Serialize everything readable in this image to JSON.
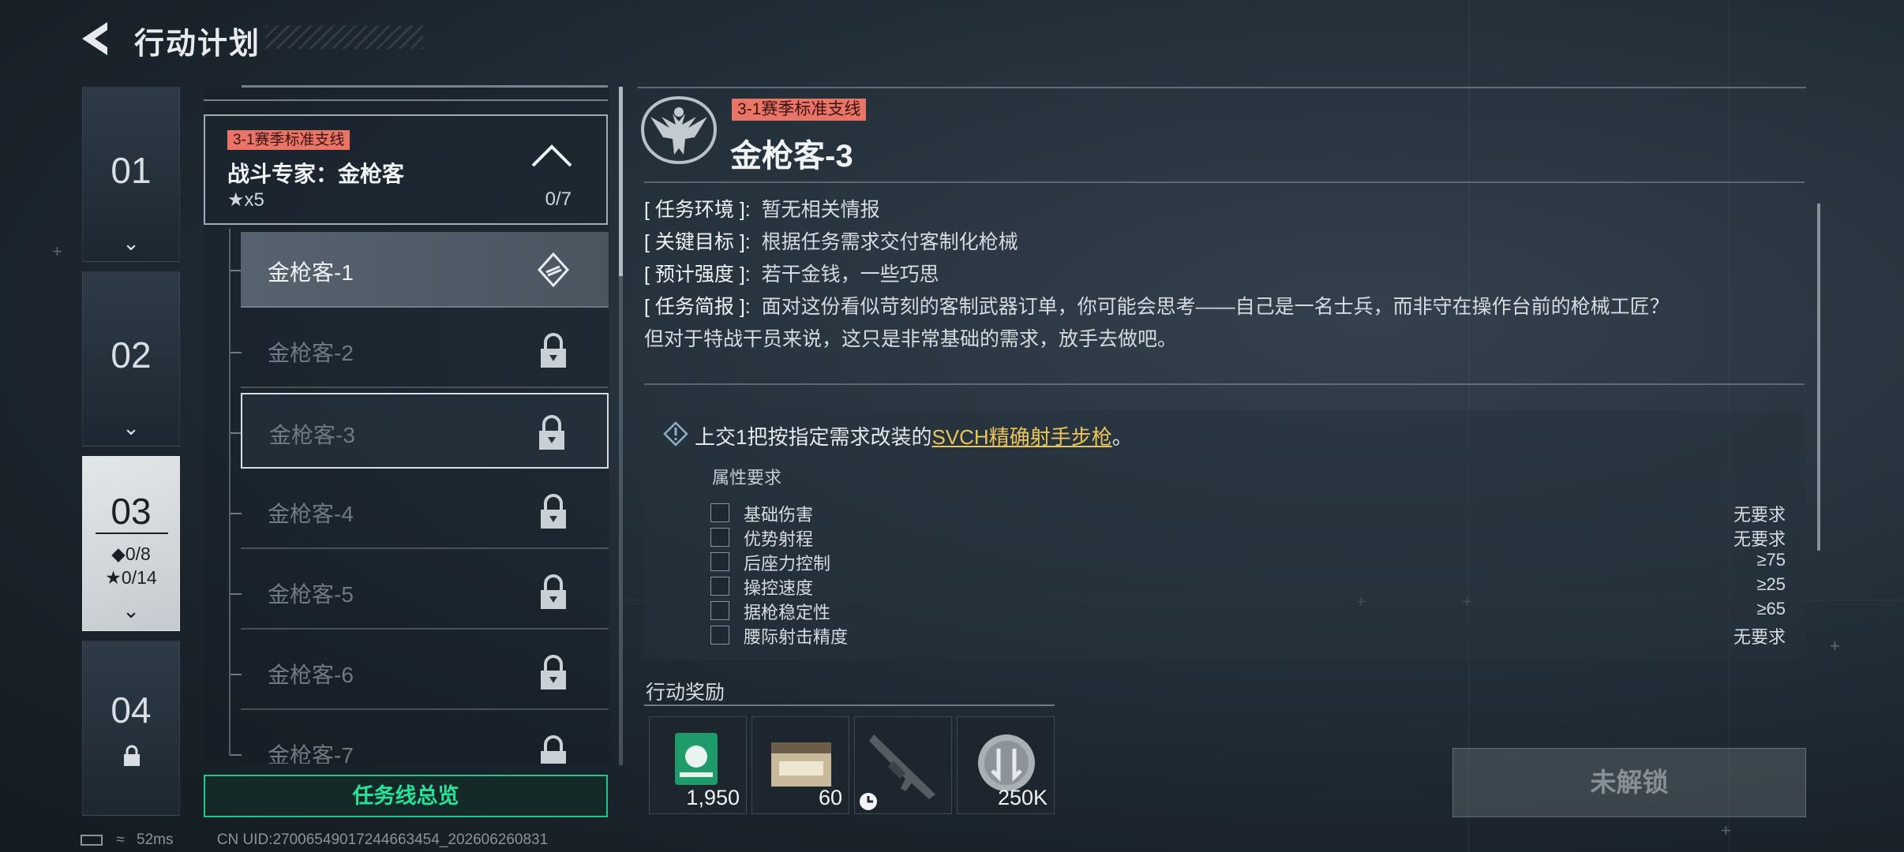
{
  "header": {
    "title": "行动计划",
    "back_icon": "back-arrow-icon"
  },
  "chapters": [
    {
      "num": "01"
    },
    {
      "num": "02"
    },
    {
      "num": "03",
      "diamond": "◆0/8",
      "star": "★0/14"
    },
    {
      "num": "04"
    }
  ],
  "questline": {
    "tag": "3-1赛季标准支线",
    "name": "战斗专家：金枪客",
    "reward": "★x5",
    "progress": "0/7",
    "overview_button": "任务线总览"
  },
  "missions": [
    {
      "label": "金枪客-1"
    },
    {
      "label": "金枪客-2"
    },
    {
      "label": "金枪客-3"
    },
    {
      "label": "金枪客-4"
    },
    {
      "label": "金枪客-5"
    },
    {
      "label": "金枪客-6"
    },
    {
      "label": "金枪客-7"
    }
  ],
  "detail": {
    "tag": "3-1赛季标准支线",
    "title": "金枪客-3",
    "env_label": "[ 任务环境 ]:",
    "env": "暂无相关情报",
    "goal_label": "[ 关键目标 ]:",
    "goal": "根据任务需求交付客制化枪械",
    "intensity_label": "[ 预计强度 ]:",
    "intensity": "若干金钱，一些巧思",
    "brief_label": "[ 任务简报 ]:",
    "brief_1": "面对这份看似苛刻的客制武器订单，你可能会思考——自己是一名士兵，而非守在操作台前的枪械工匠？",
    "brief_2": "但对于特战干员来说，这只是非常基础的需求，放手去做吧。"
  },
  "objective": {
    "prefix": "上交1把按指定需求改装的",
    "weapon": "SVCH精确射手步枪",
    "suffix": "。",
    "attr_title": "属性要求",
    "attrs": [
      {
        "name": "基础伤害",
        "value": "无要求"
      },
      {
        "name": "优势射程",
        "value": "无要求"
      },
      {
        "name": "后座力控制",
        "value": "≥75"
      },
      {
        "name": "操控速度",
        "value": "≥25"
      },
      {
        "name": "据枪稳定性",
        "value": "≥65"
      },
      {
        "name": "腰际射击精度",
        "value": "无要求"
      }
    ]
  },
  "rewards": {
    "title": "行动奖励",
    "items": [
      {
        "qty": "1,950"
      },
      {
        "qty": "60"
      },
      {
        "qty": ""
      },
      {
        "qty": "250K"
      }
    ]
  },
  "action_button": "未解锁",
  "status": {
    "ping": "52ms",
    "uid": "CN UID:27006549017244663454_202606260831"
  },
  "colors": {
    "tag_bg": "#e97566",
    "accent_green": "#25e39a",
    "link_yellow": "#e9c55a"
  }
}
